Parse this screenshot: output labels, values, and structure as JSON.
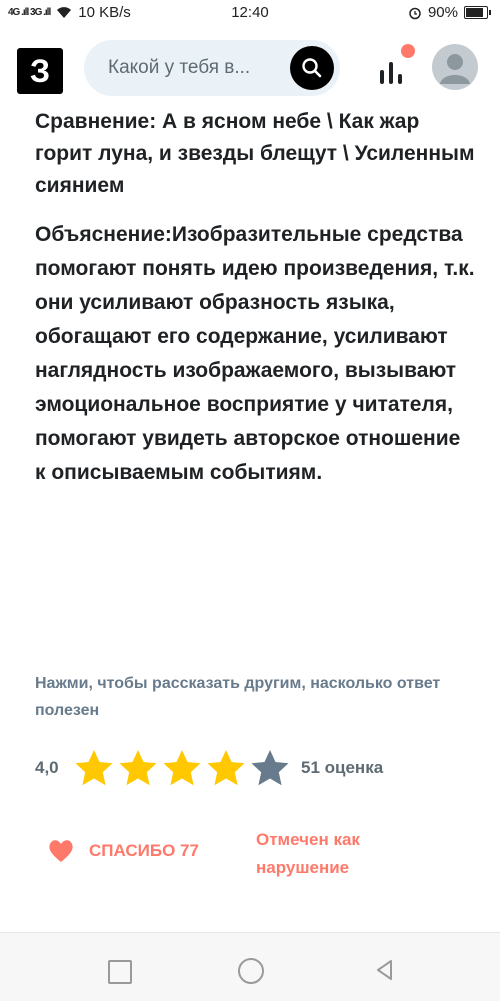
{
  "status_bar": {
    "signal": "4G .ıll 3G .ıll",
    "speed": "10 KB/s",
    "time": "12:40",
    "battery": "90%"
  },
  "header": {
    "logo": "З",
    "search_placeholder": "Какой у тебя в..."
  },
  "answer": {
    "comparison": "Сравнение: А в ясном небе  \\ Как жар горит луна, и звезды блещут  \\ Усиленным сиянием",
    "explanation": "Объяснение:Изобразительные средства помогают понять идею произведения, т.к. они усиливают образность языка, обогащают его содержание, усиливают наглядность изображаемого, вызывают эмоциональное восприятие у читателя, помогают увидеть авторское отношение к описываемым событиям."
  },
  "feedback": {
    "prompt": "Нажми, чтобы рассказать другим, насколько ответ полезен",
    "rating_value": "4,0",
    "rating_stars": 4,
    "rating_max": 5,
    "rating_count": "51 оценка",
    "thanks_label": "СПАСИБО 77",
    "violation_label": "Отмечен как нарушение"
  },
  "colors": {
    "star_filled": "#ffc800",
    "star_empty": "#687b8c",
    "accent": "#ff796b"
  }
}
